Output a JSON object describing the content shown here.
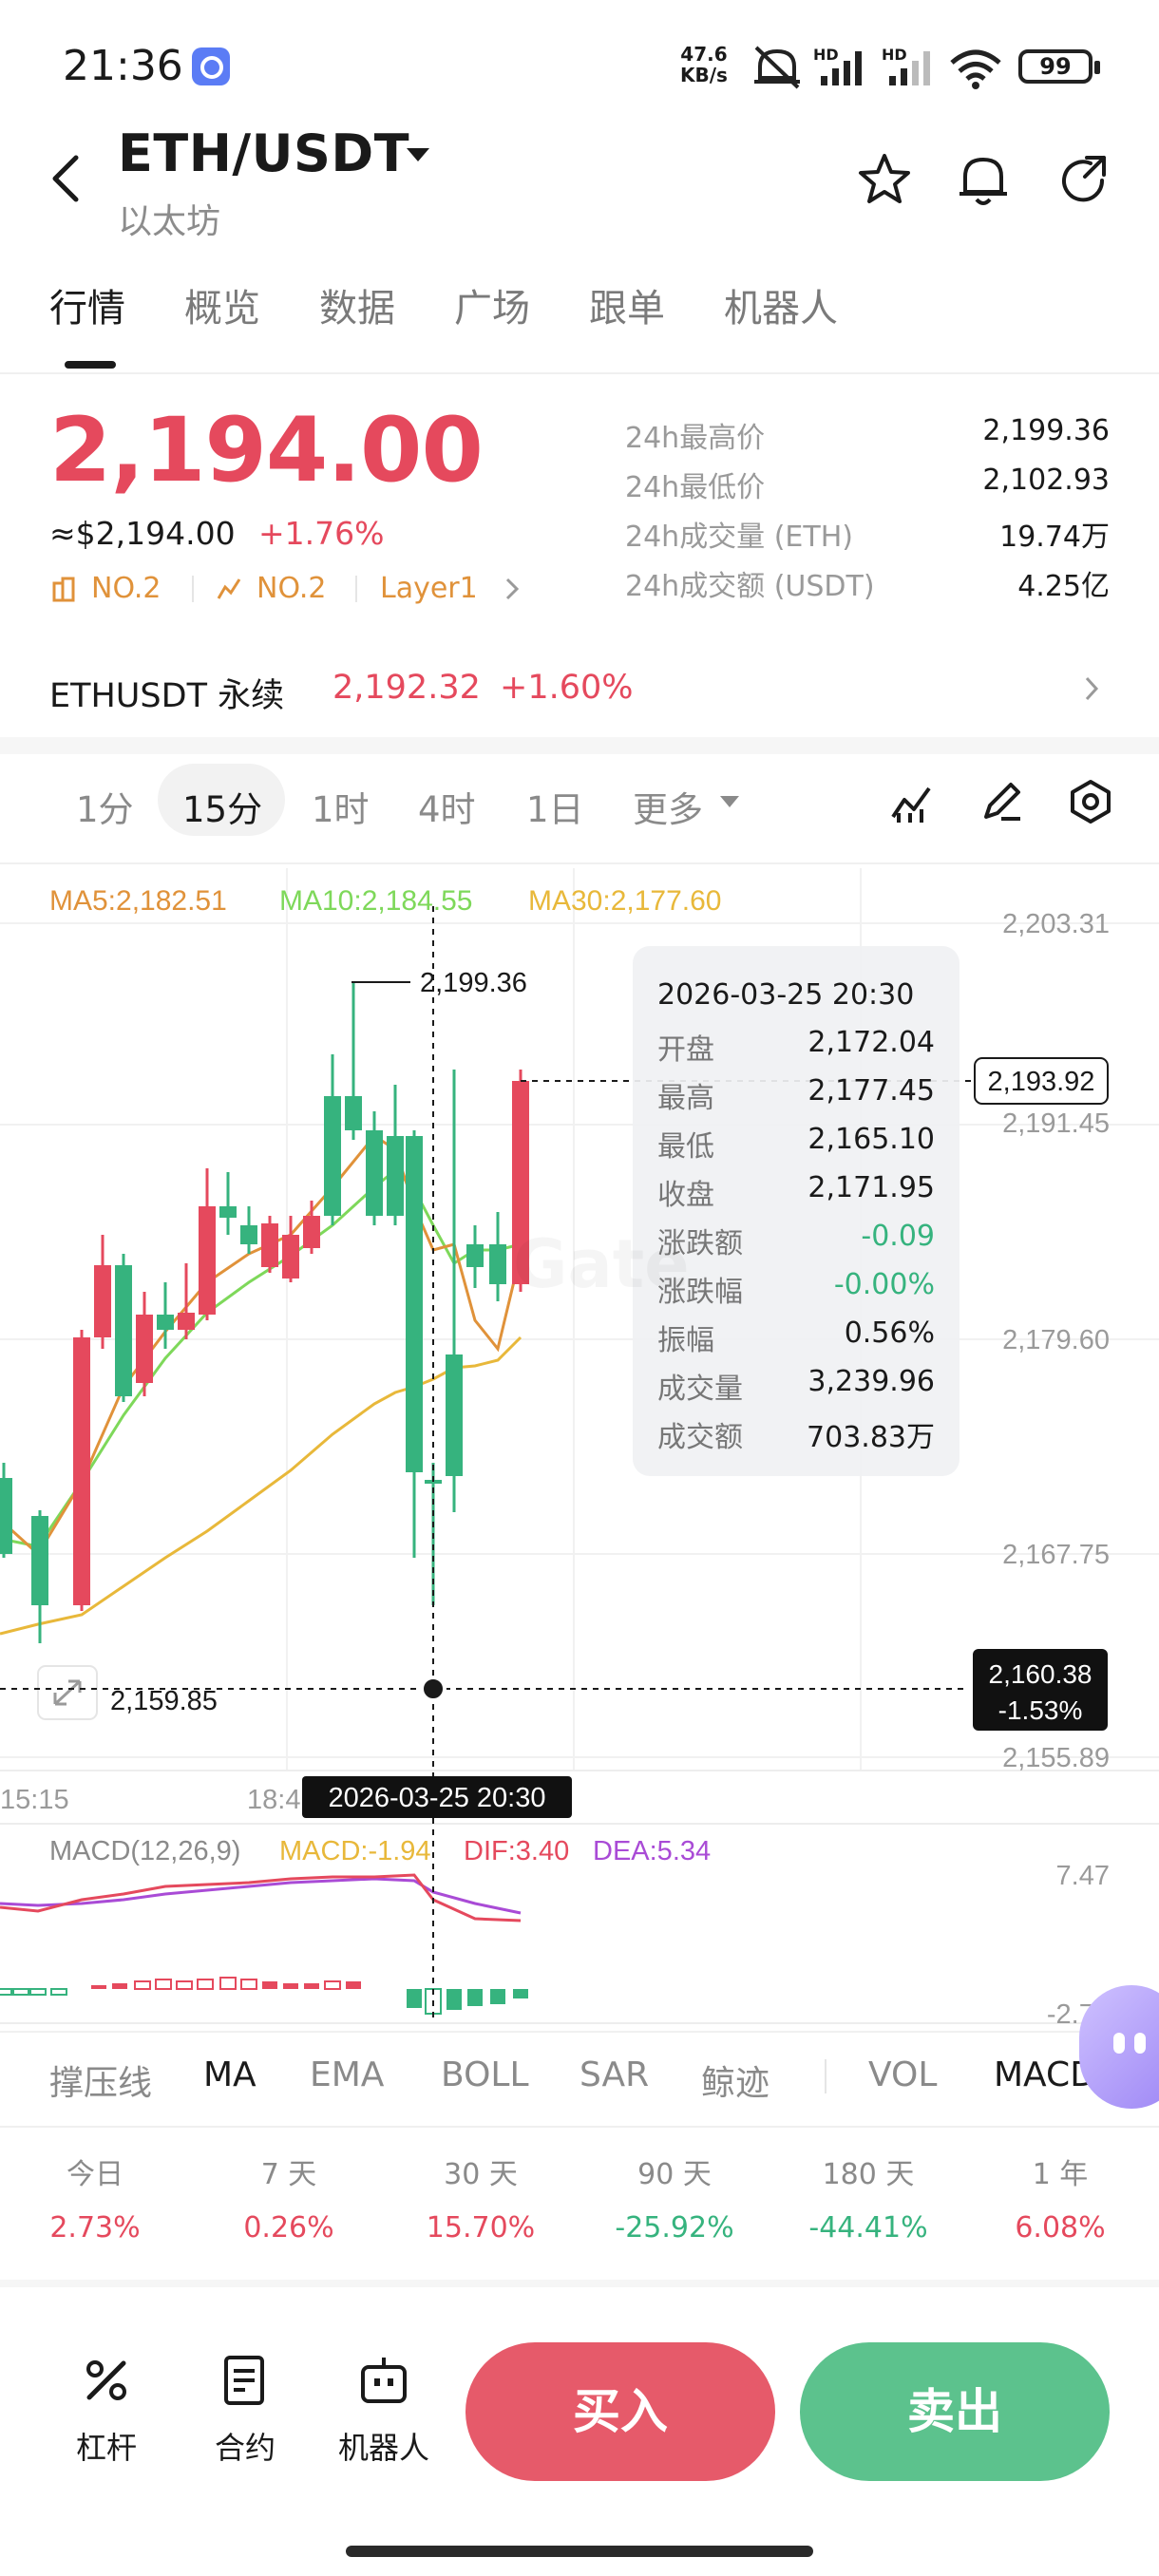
{
  "status_bar": {
    "time": "21:36",
    "net_speed_value": "47.6",
    "net_speed_unit": "KB/s",
    "sim1": "HD",
    "sim2": "HD",
    "battery": "99"
  },
  "header": {
    "pair": "ETH/USDT",
    "name": "以太坊"
  },
  "tabs": [
    "行情",
    "概览",
    "数据",
    "广场",
    "跟单",
    "机器人"
  ],
  "price": {
    "last": "2,194.00",
    "usd": "≈$2,194.00",
    "change_pct": "+1.76%",
    "tag_rank1": "NO.2",
    "tag_rank2": "NO.2",
    "tag_sector": "Layer1",
    "stats": [
      {
        "label": "24h最高价",
        "value": "2,199.36"
      },
      {
        "label": "24h最低价",
        "value": "2,102.93"
      },
      {
        "label": "24h成交量 (ETH)",
        "value": "19.74万"
      },
      {
        "label": "24h成交额 (USDT)",
        "value": "4.25亿"
      }
    ]
  },
  "perpetual": {
    "name": "ETHUSDT 永续",
    "price": "2,192.32",
    "change": "+1.60%"
  },
  "intervals": [
    "1分",
    "15分",
    "1时",
    "4时",
    "1日",
    "更多"
  ],
  "active_interval": "15分",
  "chart": {
    "ma5": "MA5:2,182.51",
    "ma10": "MA10:2,184.55",
    "ma30": "MA30:2,177.60",
    "y_labels": [
      "2,203.31",
      "2,191.45",
      "2,179.60",
      "2,167.75",
      "2,155.89"
    ],
    "high_marker": "2,199.36",
    "low_marker": "2,159.85",
    "last_price_tag": "2,193.92",
    "crosshair_price": "2,160.38",
    "crosshair_pct": "-1.53%",
    "x_label_left": "15:15",
    "x_label_mid": "18:4",
    "crosshair_time": "2026-03-25 20:30",
    "macd_title": "MACD(12,26,9)",
    "macd_val": "MACD:-1.94",
    "dif_val": "DIF:3.40",
    "dea_val": "DEA:5.34",
    "macd_y_top": "7.47",
    "macd_y_bottom": "-2.79",
    "colors": {
      "up": "#e5495d",
      "down": "#36b37e",
      "ma5": "#e0923a",
      "ma10": "#7ed85a",
      "ma30": "#e8b83a",
      "dif": "#e5495d",
      "dea": "#a94bd6"
    }
  },
  "tooltip": {
    "time": "2026-03-25 20:30",
    "rows": [
      {
        "label": "开盘",
        "value": "2,172.04"
      },
      {
        "label": "最高",
        "value": "2,177.45"
      },
      {
        "label": "最低",
        "value": "2,165.10"
      },
      {
        "label": "收盘",
        "value": "2,171.95"
      },
      {
        "label": "涨跌额",
        "value": "-0.09"
      },
      {
        "label": "涨跌幅",
        "value": "-0.00%"
      },
      {
        "label": "振幅",
        "value": "0.56%"
      },
      {
        "label": "成交量",
        "value": "3,239.96"
      },
      {
        "label": "成交额",
        "value": "703.83万"
      }
    ]
  },
  "indicators": [
    "撑压线",
    "MA",
    "EMA",
    "BOLL",
    "SAR",
    "鲸迹",
    "VOL",
    "MACD"
  ],
  "performance": [
    {
      "label": "今日",
      "value": "2.73%"
    },
    {
      "label": "7 天",
      "value": "0.26%"
    },
    {
      "label": "30 天",
      "value": "15.70%"
    },
    {
      "label": "90 天",
      "value": "-25.92%"
    },
    {
      "label": "180 天",
      "value": "-44.41%"
    },
    {
      "label": "1 年",
      "value": "6.08%"
    }
  ],
  "bottom_bar": {
    "leverage": "杠杆",
    "contract": "合约",
    "robot": "机器人",
    "buy": "买入",
    "sell": "卖出"
  }
}
